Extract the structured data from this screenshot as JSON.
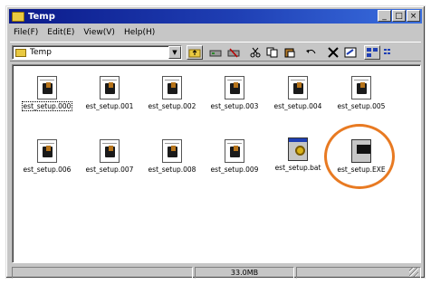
{
  "window": {
    "title": "Temp"
  },
  "menu": {
    "items": [
      "File(F)",
      "Edit(E)",
      "View(V)",
      "Help(H)"
    ]
  },
  "address": {
    "value": "Temp"
  },
  "toolbar": {
    "buttons": [
      {
        "icon": "up-folder-icon"
      },
      {
        "icon": "map-drive-icon"
      },
      {
        "icon": "disconnect-icon"
      },
      {
        "icon": "cut-icon"
      },
      {
        "icon": "copy-icon"
      },
      {
        "icon": "paste-icon"
      },
      {
        "icon": "undo-icon"
      },
      {
        "icon": "delete-icon"
      },
      {
        "icon": "properties-icon"
      },
      {
        "icon": "large-icons-icon"
      },
      {
        "icon": "small-icons-icon"
      }
    ]
  },
  "files": [
    {
      "name": "est_setup.000",
      "type": "doc",
      "selected": true
    },
    {
      "name": "est_setup.001",
      "type": "doc"
    },
    {
      "name": "est_setup.002",
      "type": "doc"
    },
    {
      "name": "est_setup.003",
      "type": "doc"
    },
    {
      "name": "est_setup.004",
      "type": "doc"
    },
    {
      "name": "est_setup.005",
      "type": "doc"
    },
    {
      "name": "est_setup.006",
      "type": "doc"
    },
    {
      "name": "est_setup.007",
      "type": "doc"
    },
    {
      "name": "est_setup.008",
      "type": "doc"
    },
    {
      "name": "est_setup.009",
      "type": "doc"
    },
    {
      "name": "est_setup.bat",
      "type": "bat"
    },
    {
      "name": "est_setup.EXE",
      "type": "exe",
      "highlighted": true
    }
  ],
  "status": {
    "size": "33.0MB"
  },
  "colors": {
    "highlight_ring": "#e87a22",
    "titlebar": "#0b1a8a"
  }
}
